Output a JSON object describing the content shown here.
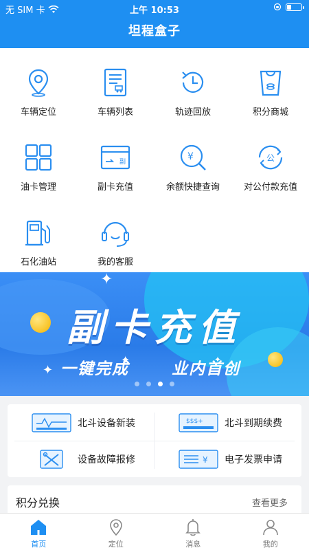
{
  "statusbar": {
    "carrier": "无 SIM 卡",
    "time": "上午 10:53",
    "battery_level": 0.3
  },
  "header": {
    "title": "坦程盒子"
  },
  "grid": [
    {
      "label": "车辆定位",
      "icon": "location-pin-icon"
    },
    {
      "label": "车辆列表",
      "icon": "vehicle-list-icon"
    },
    {
      "label": "轨迹回放",
      "icon": "track-replay-clock-icon"
    },
    {
      "label": "积分商城",
      "icon": "points-mall-bag-icon"
    },
    {
      "label": "油卡管理",
      "icon": "fuel-card-grid-icon"
    },
    {
      "label": "副卡充值",
      "icon": "sub-card-recharge-icon"
    },
    {
      "label": "余额快捷查询",
      "icon": "balance-search-yen-icon"
    },
    {
      "label": "对公付款充值",
      "icon": "corporate-payment-icon"
    },
    {
      "label": "石化油站",
      "icon": "gas-station-icon"
    },
    {
      "label": "我的客服",
      "icon": "customer-service-headset-icon"
    }
  ],
  "banner": {
    "title": "副卡充值",
    "sub_left": "一键完成",
    "sub_right": "业内首创",
    "slide_count": 4,
    "active_slide": 3
  },
  "services": [
    {
      "label": "北斗设备新装",
      "icon": "device-install-icon"
    },
    {
      "label": "北斗到期续费",
      "icon": "renewal-fee-icon"
    },
    {
      "label": "设备故障报修",
      "icon": "repair-tools-icon"
    },
    {
      "label": "电子发票申请",
      "icon": "e-invoice-icon"
    }
  ],
  "points_section": {
    "title": "积分兑换",
    "more": "查看更多"
  },
  "tabbar": [
    {
      "label": "首页",
      "icon": "home-icon",
      "active": true
    },
    {
      "label": "定位",
      "icon": "location-icon",
      "active": false
    },
    {
      "label": "消息",
      "icon": "bell-icon",
      "active": false
    },
    {
      "label": "我的",
      "icon": "user-icon",
      "active": false
    }
  ],
  "colors": {
    "primary": "#1e8ff2",
    "icon_blue": "#2a8ef0",
    "background": "#f2f3f5"
  }
}
